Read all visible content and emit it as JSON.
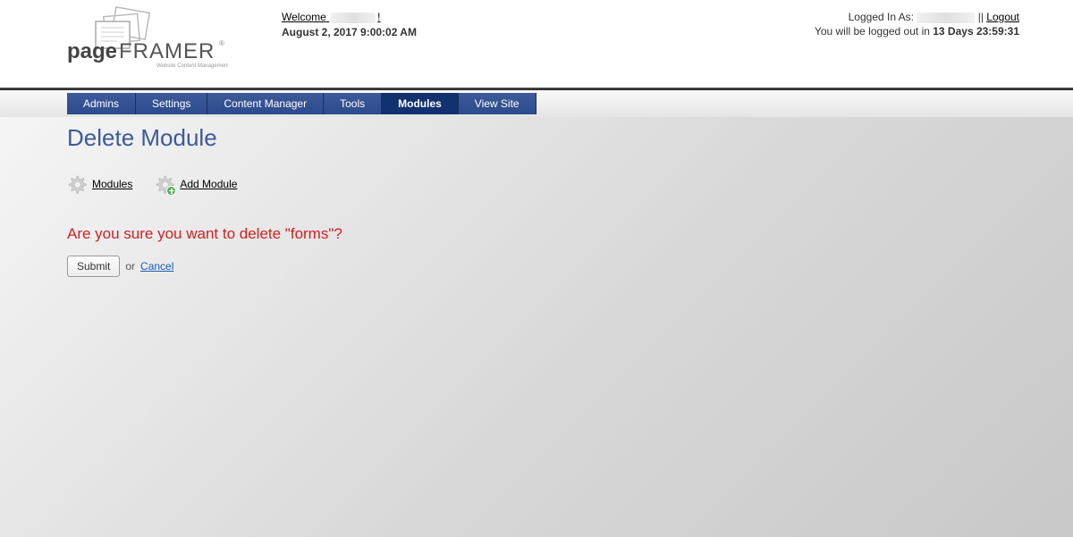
{
  "header": {
    "logo": {
      "brand_prefix": "page",
      "brand_suffix": "FRAMER",
      "tagline": "Website Content Management"
    },
    "welcome_prefix": "Welcome",
    "welcome_suffix": "!",
    "datetime": "August 2, 2017 9:00:02 AM",
    "logged_in_label": "Logged In As:",
    "separator": " || ",
    "logout_label": "Logout",
    "countdown_prefix": "You will be logged out in ",
    "countdown_value": "13 Days 23:59:31"
  },
  "nav": {
    "tabs": [
      {
        "label": "Admins",
        "active": false
      },
      {
        "label": "Settings",
        "active": false
      },
      {
        "label": "Content Manager",
        "active": false
      },
      {
        "label": "Tools",
        "active": false
      },
      {
        "label": "Modules",
        "active": true
      },
      {
        "label": "View Site",
        "active": false
      }
    ]
  },
  "page": {
    "title": "Delete Module",
    "actions": {
      "modules_label": "Modules",
      "add_module_label": "Add Module"
    },
    "confirm_text": "Are you sure you want to delete \"forms\"?",
    "submit_label": "Submit",
    "or_text": "or",
    "cancel_label": "Cancel"
  }
}
